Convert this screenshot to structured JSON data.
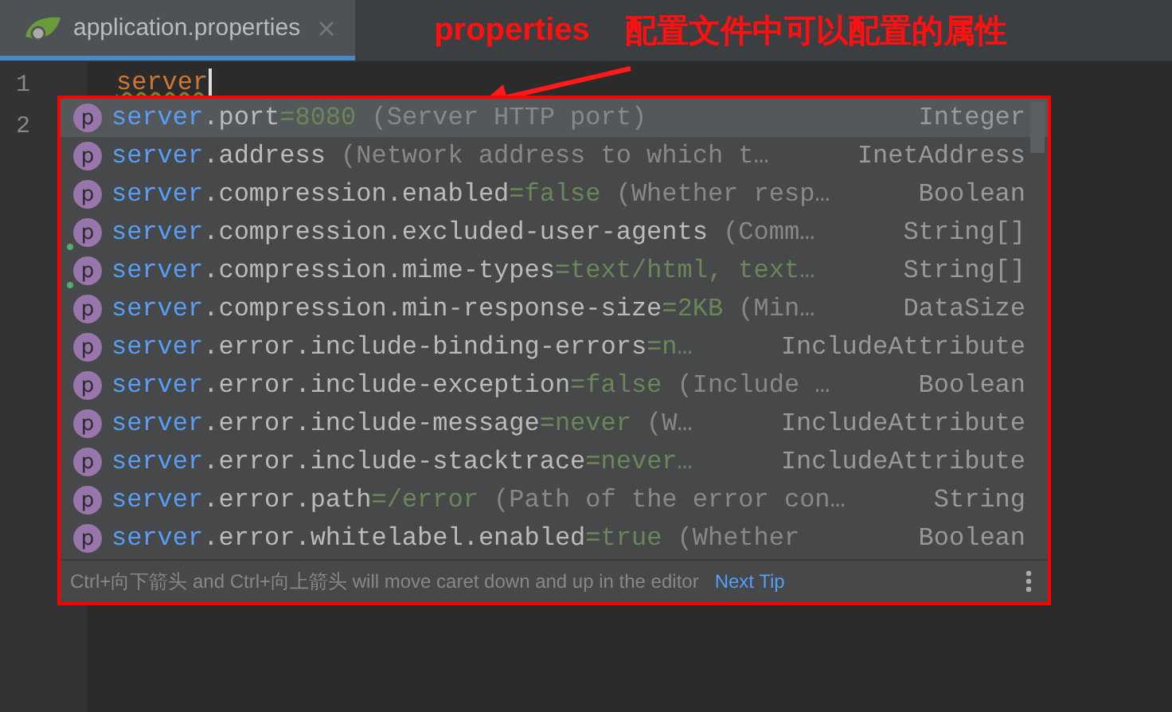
{
  "tab": {
    "title": "application.properties",
    "selected": true
  },
  "editor": {
    "line_numbers": [
      "1",
      "2"
    ],
    "typed_text": "server"
  },
  "annotation": {
    "label": "properties",
    "text": "配置文件中可以配置的属性"
  },
  "completion": {
    "items": [
      {
        "icon": "p",
        "match": "server",
        "rest": ".port",
        "value": "=8080",
        "description": "(Server HTTP port)",
        "type": "Integer",
        "selected": true,
        "dot": false
      },
      {
        "icon": "p",
        "match": "server",
        "rest": ".address",
        "value": "",
        "description": "(Network address to which t…",
        "type": "InetAddress",
        "selected": false,
        "dot": false
      },
      {
        "icon": "p",
        "match": "server",
        "rest": ".compression.enabled",
        "value": "=false",
        "description": "(Whether resp…",
        "type": "Boolean",
        "selected": false,
        "dot": false
      },
      {
        "icon": "p",
        "match": "server",
        "rest": ".compression.excluded-user-agents",
        "value": "",
        "description": "(Comm…",
        "type": "String[]",
        "selected": false,
        "dot": true
      },
      {
        "icon": "p",
        "match": "server",
        "rest": ".compression.mime-types",
        "value": "=text/html, text…",
        "type": "String[]",
        "selected": false,
        "dot": true
      },
      {
        "icon": "p",
        "match": "server",
        "rest": ".compression.min-response-size",
        "value": "=2KB",
        "description": "(Min…",
        "type": "DataSize",
        "selected": false,
        "dot": false
      },
      {
        "icon": "p",
        "match": "server",
        "rest": ".error.include-binding-errors",
        "value": "=n…",
        "type": "IncludeAttribute",
        "selected": false,
        "dot": false
      },
      {
        "icon": "p",
        "match": "server",
        "rest": ".error.include-exception",
        "value": "=false",
        "description": "(Include …",
        "type": "Boolean",
        "selected": false,
        "dot": false
      },
      {
        "icon": "p",
        "match": "server",
        "rest": ".error.include-message",
        "value": "=never",
        "description": "(W…",
        "type": "IncludeAttribute",
        "selected": false,
        "dot": false
      },
      {
        "icon": "p",
        "match": "server",
        "rest": ".error.include-stacktrace",
        "value": "=never…",
        "type": "IncludeAttribute",
        "selected": false,
        "dot": false
      },
      {
        "icon": "p",
        "match": "server",
        "rest": ".error.path",
        "value": "=/error",
        "description": "(Path of the error con…",
        "type": "String",
        "selected": false,
        "dot": false
      },
      {
        "icon": "p",
        "match": "server",
        "rest": ".error.whitelabel.enabled",
        "value": "=true",
        "description": "(Whether",
        "type": "Boolean",
        "selected": false,
        "dot": false
      }
    ],
    "hint": "Ctrl+向下箭头 and Ctrl+向上箭头 will move caret down and up in the editor",
    "hint_link": "Next Tip"
  }
}
